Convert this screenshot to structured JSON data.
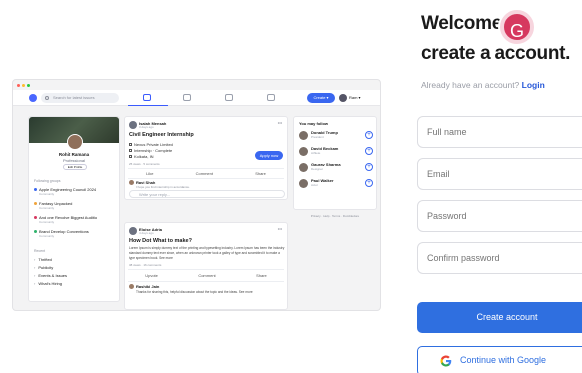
{
  "colors": {
    "primary": "#2f6fe0",
    "avatar": "#d6385f",
    "link": "#2758d8"
  },
  "form": {
    "title_line1": "Welcome",
    "title_line2_a": "create a",
    "title_line2_b": "account.",
    "avatar_letter": "G",
    "already_text": "Already have an account?",
    "login_link": "Login",
    "fields": {
      "full_name": "Full name",
      "email": "Email",
      "password": "Password",
      "confirm_password": "Confirm password"
    },
    "create_button": "Create account",
    "google_button": "Continue with Google",
    "google_icon": "google-g-icon"
  },
  "mock": {
    "search_placeholder": "Search for latest issues",
    "create_label": "Create ▾",
    "me_label": "Ram ▾",
    "profile": {
      "name": "Rohit Ramana",
      "role": "Professional",
      "button": "Edit Profile",
      "groups_title": "Following groups",
      "groups": [
        {
          "name": "Apple Engineering Council 2024",
          "sub": "Community",
          "color": "#3a67f0"
        },
        {
          "name": "Fantasy Unpacked",
          "sub": "Community",
          "color": "#f0a33a"
        },
        {
          "name": "And one Revolve Biggest Auditio",
          "sub": "Community",
          "color": "#d6385f"
        },
        {
          "name": "Brand Develop Conventions",
          "sub": "Community",
          "color": "#2fb36b"
        }
      ],
      "recent_title": "Recent",
      "recent": [
        "Thrifted",
        "Publicity",
        "Events & Issues",
        "What's Hiring"
      ]
    },
    "post1": {
      "author": "Isaiah Mensah",
      "time": "3 days ago",
      "title": "Civil Engineer Internship",
      "meta": [
        "Nexus Private Limited",
        "Internship · Complete",
        "Kolkata, IN"
      ],
      "apply": "Apply now",
      "stats": "25 views · 5 comments",
      "actions": [
        "Like",
        "Comment",
        "Share"
      ],
      "commenter": "Ravi Shah",
      "comment_text": "I hope you find internship in accordance.",
      "comment_placeholder": "Write your reply..."
    },
    "post2": {
      "author": "Eloise Adria",
      "time": "4 days ago",
      "title": "How Dot What to make?",
      "body": "Lorem Ipsum is simply dummy text of the printing and typesetting industry. Lorem Ipsum has been the industry standard dummy text ever since, when an unknown printer took a galley of type and scrambled it to make a type specimen book. See more",
      "stats": "38 views · 16 comments",
      "actions": [
        "Upvote",
        "Comment",
        "Share"
      ],
      "commenter": "Rashiki Jain",
      "comment_text": "Thanks for sharing this, helpful discussion about the topic and the ideas. See more"
    },
    "suggest": {
      "title": "You may follow",
      "people": [
        {
          "name": "Donald Trump",
          "role": "President"
        },
        {
          "name": "David Beckam",
          "role": "Athlete"
        },
        {
          "name": "Gaurav Sharma",
          "role": "Designer"
        },
        {
          "name": "Paul Walker",
          "role": "Actor"
        }
      ]
    },
    "footer": "Privacy · Help · Terms · Dumbledore"
  }
}
